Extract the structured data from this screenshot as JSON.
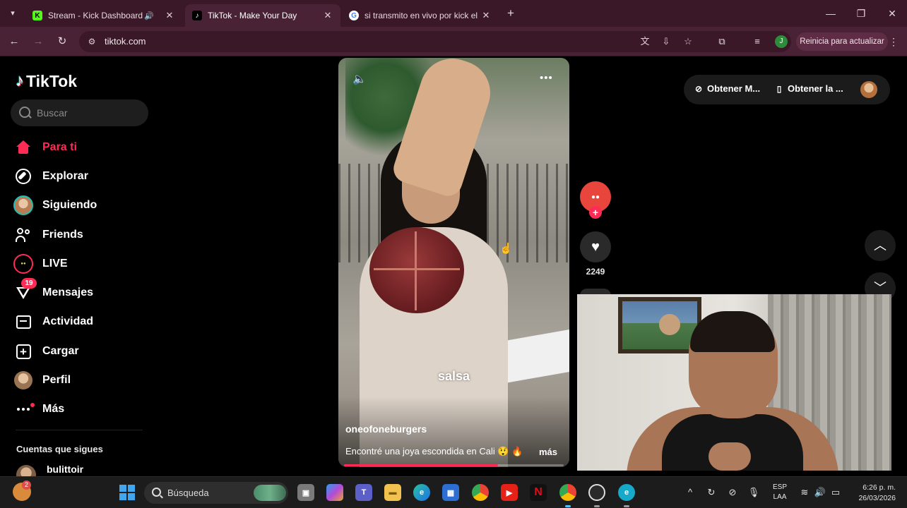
{
  "browser": {
    "tabs": [
      {
        "title": "Stream - Kick Dashboard",
        "favicon": "kick-icon",
        "audio": true
      },
      {
        "title": "TikTok - Make Your Day",
        "favicon": "tiktok-icon",
        "active": true
      },
      {
        "title": "si transmito en vivo por kick el",
        "favicon": "google-icon"
      }
    ],
    "url": "tiktok.com",
    "update_label": "Reinicia para actualizar",
    "profile_initial": "J"
  },
  "tiktok": {
    "logo": "TikTok",
    "search_placeholder": "Buscar",
    "nav": [
      {
        "label": "Para ti",
        "icon": "home-icon",
        "active": true
      },
      {
        "label": "Explorar",
        "icon": "compass-icon"
      },
      {
        "label": "Siguiendo",
        "icon": "following-avatar-icon"
      },
      {
        "label": "Friends",
        "icon": "friends-icon"
      },
      {
        "label": "LIVE",
        "icon": "live-icon"
      },
      {
        "label": "Mensajes",
        "icon": "messages-icon",
        "badge": "19"
      },
      {
        "label": "Actividad",
        "icon": "activity-icon"
      },
      {
        "label": "Cargar",
        "icon": "upload-icon"
      },
      {
        "label": "Perfil",
        "icon": "profile-avatar-icon"
      },
      {
        "label": "Más",
        "icon": "more-icon"
      }
    ],
    "following_title": "Cuentas que sigues",
    "following": [
      {
        "name": "bulittoir"
      }
    ],
    "video": {
      "overlay_text": "salsa",
      "author": "oneofoneburgers",
      "description": "Encontré una joya escondida en Cali 😲 🔥",
      "more_label": "más",
      "progress": 0.7
    },
    "actions": {
      "like_count": "2249"
    },
    "get_pill": {
      "item1": "Obtener M...",
      "item2": "Obtener la ..."
    }
  },
  "taskbar": {
    "weather_badge": "2",
    "search_label": "Búsqueda",
    "lang_line1": "ESP",
    "lang_line2": "LAA",
    "time": "6:26 p. m.",
    "date": "26/03/2026"
  },
  "colors": {
    "tiktok_accent": "#fe2c55",
    "chrome_frame": "#3a1828",
    "chrome_toolbar": "#4a2236"
  }
}
